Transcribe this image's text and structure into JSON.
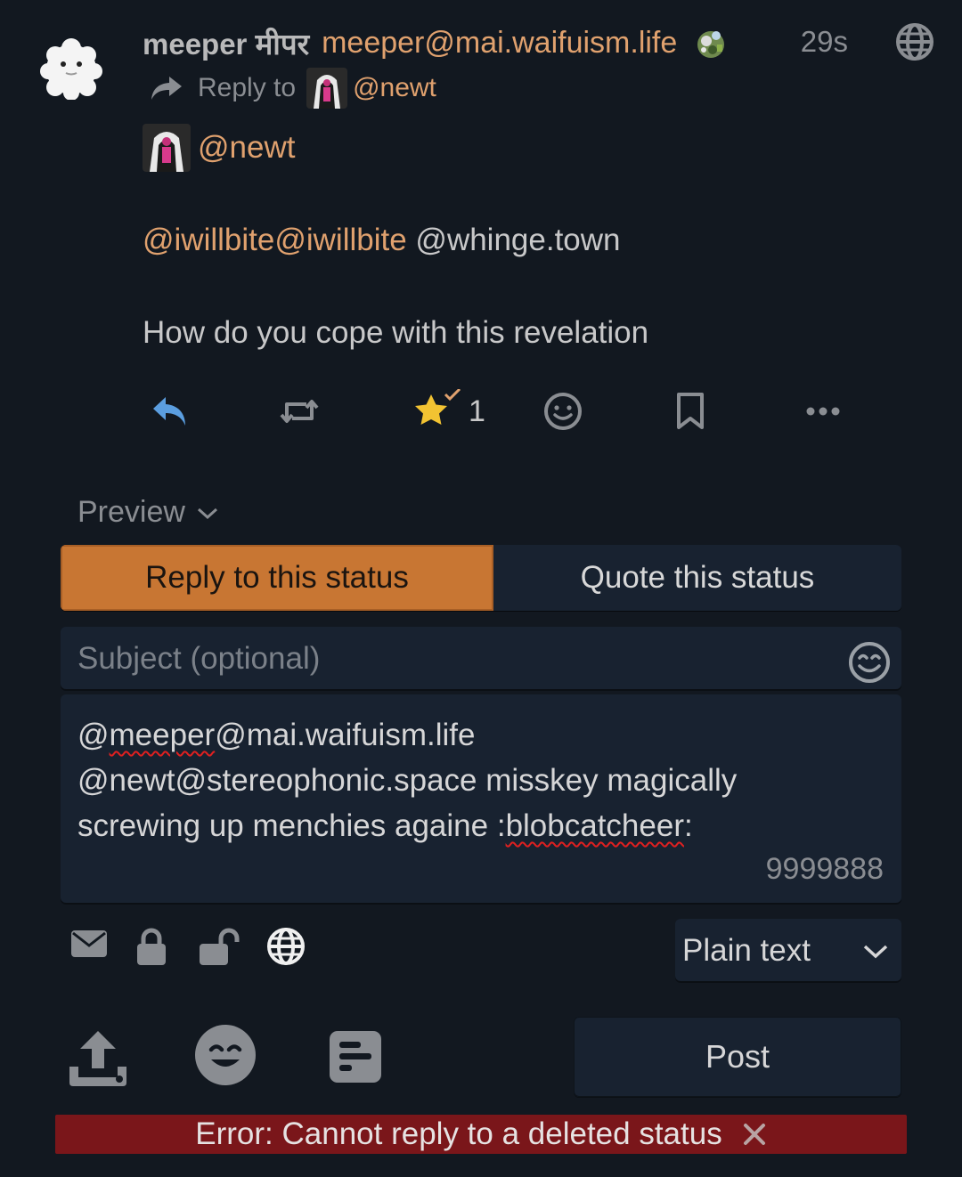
{
  "status": {
    "display_name": "meeper मीपर",
    "account": "meeper@mai.waifuism.life",
    "time": "29s",
    "reply_to_label": "Reply to",
    "reply_to_user": "@newt",
    "content": {
      "line1_mention": "@newt",
      "line2_mention": "@iwillbite@iwillbite",
      "line2_plain": " @whinge.town",
      "line3": "How do you cope with this revelation"
    },
    "fav_count": "1"
  },
  "composer": {
    "preview_label": "Preview",
    "tab_reply": "Reply to this status",
    "tab_quote": "Quote this status",
    "subject_placeholder": "Subject (optional)",
    "text": {
      "line1_prefix": "@",
      "line1_word": "meeper",
      "line1_suffix": "@mai.waifuism.life",
      "line2": "@newt@stereophonic.space misskey magically",
      "line3_prefix": "screwing up menchies againe :",
      "line3_word": "blobcatcheer",
      "line3_suffix": ":"
    },
    "char_count": "9999888",
    "format": "Plain text",
    "post_label": "Post"
  },
  "error": {
    "message": "Error: Cannot reply to a deleted status"
  },
  "colors": {
    "background": "#121820",
    "accent": "#e0a16e",
    "tab_active": "#c87633",
    "error_bg": "#7a161a",
    "reply_icon": "#5b9ee0",
    "star": "#f2c332"
  },
  "icons": {
    "reply": "reply-icon",
    "repeat": "retweet-icon",
    "favorite": "star-icon",
    "react": "smile-icon",
    "bookmark": "bookmark-icon",
    "more": "ellipsis-icon",
    "visibility": [
      "envelope-icon",
      "lock-icon",
      "lock-open-icon",
      "globe-icon"
    ],
    "media": [
      "upload-icon",
      "emoji-icon",
      "poll-icon"
    ]
  }
}
